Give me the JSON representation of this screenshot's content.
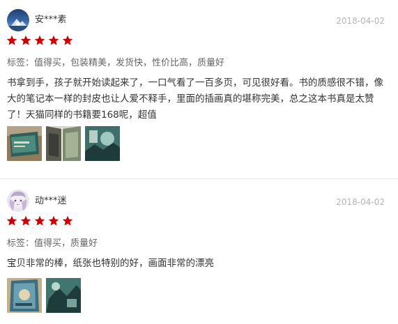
{
  "reviews": [
    {
      "user": "安***素",
      "date": "2018-04-02",
      "rating": 5,
      "tags": "标签：值得买，包装精美，发货快，性价比高，质量好",
      "content": "书拿到手，孩子就开始读起来了，一口气看了一百多页，可见很好看。书的质感很不错，像大的笔记本一样的封皮也让人爱不释手，里面的插画真的堪称完美，总之这本书真是太赞了！天猫同样的书籍要168呢，超值",
      "photo_count": 3
    },
    {
      "user": "动***迷",
      "date": "2018-04-02",
      "rating": 5,
      "tags": "标签：值得买，质量好",
      "content": "宝贝非常的棒，纸张也特别的好，画面非常的漂亮",
      "photo_count": 2
    }
  ],
  "colors": {
    "star": "#cc0000",
    "date": "#b5b5b5",
    "tags": "#666666",
    "divider": "#e8e8e8"
  },
  "icons": {
    "star": "star-icon",
    "avatar": "avatar"
  }
}
